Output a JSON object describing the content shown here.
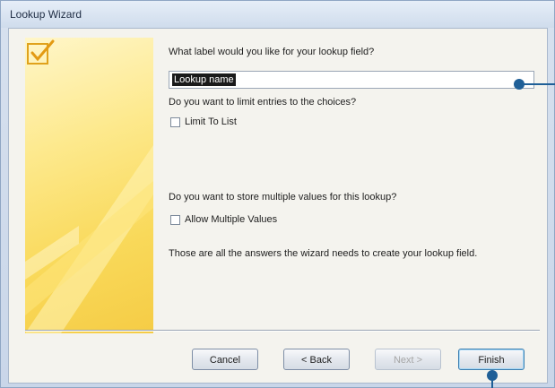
{
  "window": {
    "title": "Lookup Wizard"
  },
  "wizard": {
    "label_question": "What label would you like for your lookup field?",
    "label_value": "Lookup name",
    "limit_question": "Do you want to limit entries to the choices?",
    "limit_checkbox": "Limit To List",
    "limit_checked": false,
    "multi_question": "Do you want to store multiple values for this lookup?",
    "multi_checkbox": "Allow Multiple Values",
    "multi_checked": false,
    "note": "Those are all the answers the wizard needs to create your lookup field."
  },
  "buttons": {
    "cancel": "Cancel",
    "back": "< Back",
    "next": "Next >",
    "finish": "Finish"
  },
  "icons": [
    "checkmark-icon"
  ],
  "colors": {
    "accent": "#1f5f97",
    "art_yellow": "#f9d95a"
  }
}
